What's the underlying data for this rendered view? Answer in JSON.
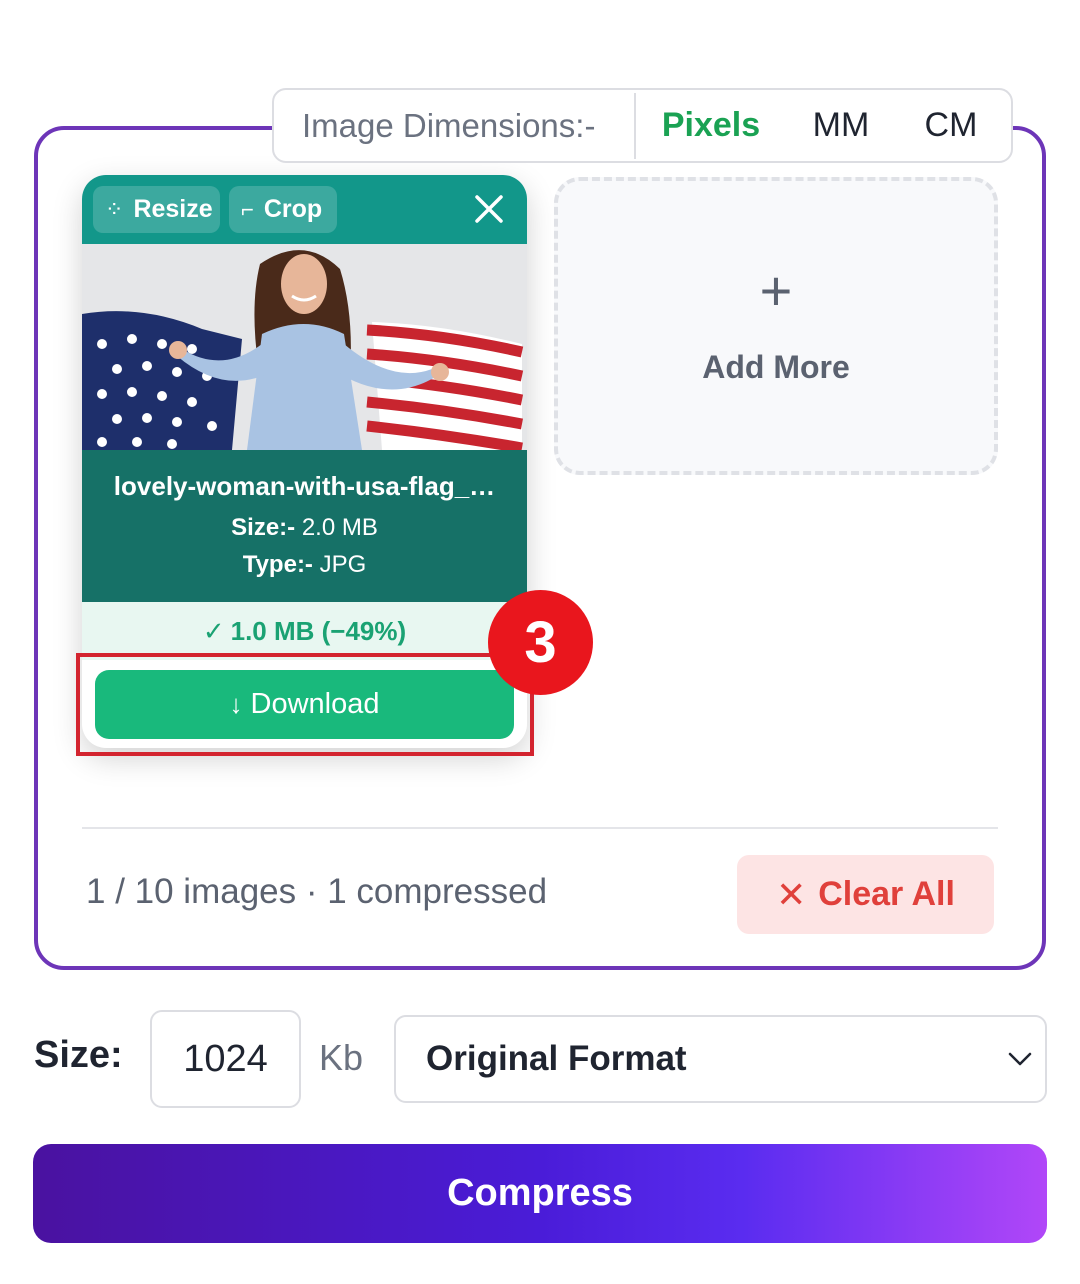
{
  "dimensions": {
    "label": "Image Dimensions:-",
    "units": [
      "Pixels",
      "MM",
      "CM"
    ],
    "active_unit": "Pixels"
  },
  "card": {
    "resize_label": "Resize",
    "crop_label": "Crop",
    "filename": "lovely-woman-with-usa-flag_…",
    "size_key": "Size:-",
    "size_value": "2.0 MB",
    "type_key": "Type:-",
    "type_value": "JPG",
    "result": "1.0 MB (−49%)",
    "download_label": "Download",
    "download_arrow": "↓"
  },
  "annotation": {
    "step": "3"
  },
  "add_more": {
    "label": "Add More",
    "plus": "+"
  },
  "status": {
    "count_text": "1 / 10 images · 1 compressed"
  },
  "clear_all": {
    "label": "Clear All",
    "icon": "✕"
  },
  "controls": {
    "size_label": "Size:",
    "size_value": "1024",
    "size_unit": "Kb",
    "format_value": "Original Format"
  },
  "compress_label": "Compress",
  "colors": {
    "panel_border": "#6d35b8",
    "active_unit": "#1aa253",
    "card_header": "#12978a",
    "card_info": "#167167",
    "download": "#19b97c",
    "highlight": "#d3242f",
    "step_badge": "#e9161d",
    "clear_bg": "#fde4e4",
    "clear_text": "#e0403b"
  }
}
